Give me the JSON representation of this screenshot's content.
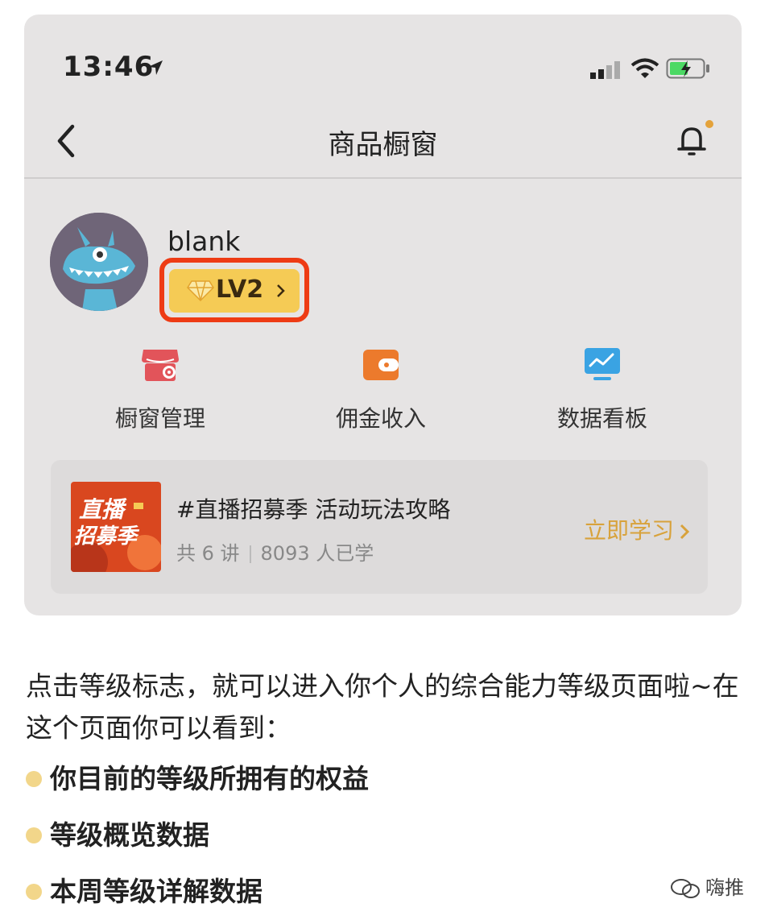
{
  "status_bar": {
    "time": "13:46"
  },
  "nav": {
    "title": "商品橱窗"
  },
  "profile": {
    "username": "blank",
    "level": "LV2"
  },
  "actions": [
    {
      "label": "橱窗管理",
      "icon": "store-settings-icon",
      "color": "#e2545a"
    },
    {
      "label": "佣金收入",
      "icon": "wallet-icon",
      "color": "#ec7a2c"
    },
    {
      "label": "数据看板",
      "icon": "chart-board-icon",
      "color": "#3aa3e3"
    }
  ],
  "promo": {
    "thumb_text_line1": "直播",
    "thumb_text_line2": "招募季",
    "title": "#直播招募季 活动玩法攻略",
    "lessons": "共 6 讲",
    "learners": "8093 人已学",
    "cta": "立即学习"
  },
  "article": {
    "description": "点击等级标志，就可以进入你个人的综合能力等级页面啦~在这个页面你可以看到：",
    "bullets": [
      "你目前的等级所拥有的权益",
      "等级概览数据",
      "本周等级详解数据"
    ]
  },
  "watermark": {
    "text": "嗨推"
  },
  "colors": {
    "accent_gold": "#d8a23b",
    "level_badge": "#f5cb55",
    "highlight_red": "#ee3b14",
    "bullet_dot": "#f2d68a"
  }
}
